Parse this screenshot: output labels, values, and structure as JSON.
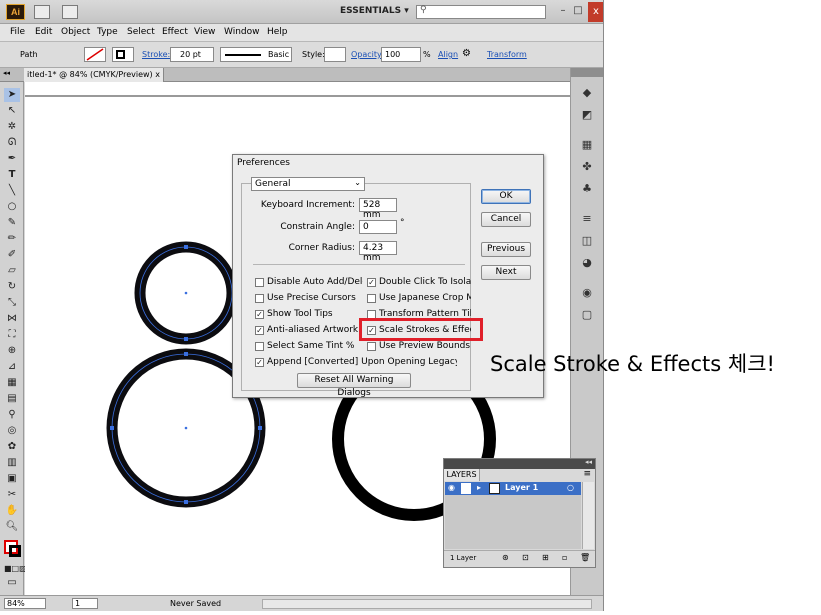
{
  "app": {
    "logo": "Ai",
    "workspace": "ESSENTIALS",
    "workspace_arrow": "▾",
    "search_icon": "⚲",
    "close_glyph": "x"
  },
  "menu": [
    "File",
    "Edit",
    "Object",
    "Type",
    "Select",
    "Effect",
    "View",
    "Window",
    "Help"
  ],
  "control_bar": {
    "selection": "Path",
    "stroke_label": "Stroke:",
    "stroke_weight": "20 pt",
    "profile": "Basic",
    "style_label": "Style:",
    "opacity_label": "Opacity:",
    "opacity_value": "100",
    "opacity_unit": "%",
    "align_label": "Align",
    "transform_label": "Transform"
  },
  "document": {
    "tab_title": "itled-1* @ 84% (CMYK/Preview)",
    "tab_close": "x",
    "panel_collapse": "◂◂"
  },
  "status_bar": {
    "zoom": "84%",
    "page": "1",
    "save_state": "Never Saved"
  },
  "preferences": {
    "title": "Preferences",
    "section": "General",
    "section_arrow": "⌄",
    "keyboard_increment_label": "Keyboard Increment:",
    "keyboard_increment_value": "528 mm",
    "constrain_angle_label": "Constrain Angle:",
    "constrain_angle_value": "0",
    "constrain_angle_unit": "°",
    "corner_radius_label": "Corner Radius:",
    "corner_radius_value": "4.23 mm",
    "checkboxes_left": [
      {
        "label": "Disable Auto Add/Delete",
        "checked": false
      },
      {
        "label": "Use Precise Cursors",
        "checked": false
      },
      {
        "label": "Show Tool Tips",
        "checked": true
      },
      {
        "label": "Anti-aliased Artwork",
        "checked": true
      },
      {
        "label": "Select Same Tint %",
        "checked": false
      },
      {
        "label": "Append [Converted] Upon Opening Legacy",
        "checked": true
      }
    ],
    "checkboxes_right": [
      {
        "label": "Double Click To Isolate",
        "checked": true
      },
      {
        "label": "Use Japanese Crop Marks",
        "checked": false
      },
      {
        "label": "Transform Pattern Tiles",
        "checked": false
      },
      {
        "label": "Scale Strokes & Effects",
        "checked": true
      },
      {
        "label": "Use Preview Bounds",
        "checked": false
      }
    ],
    "reset_button": "Reset All Warning Dialogs",
    "ok_button": "OK",
    "cancel_button": "Cancel",
    "previous_button": "Previous",
    "next_button": "Next"
  },
  "layers_panel": {
    "tab": "LAYERS",
    "layer_name": "Layer 1",
    "count": "1 Layer",
    "menu_glyph": "≡",
    "collapse_glyph": "◂◂"
  },
  "annotation": "Scale Stroke & Effects 체크!",
  "colors": {
    "highlight": "#e0202a",
    "selection_path": "#3a6fe0",
    "layer_row": "#3b6fc6"
  }
}
